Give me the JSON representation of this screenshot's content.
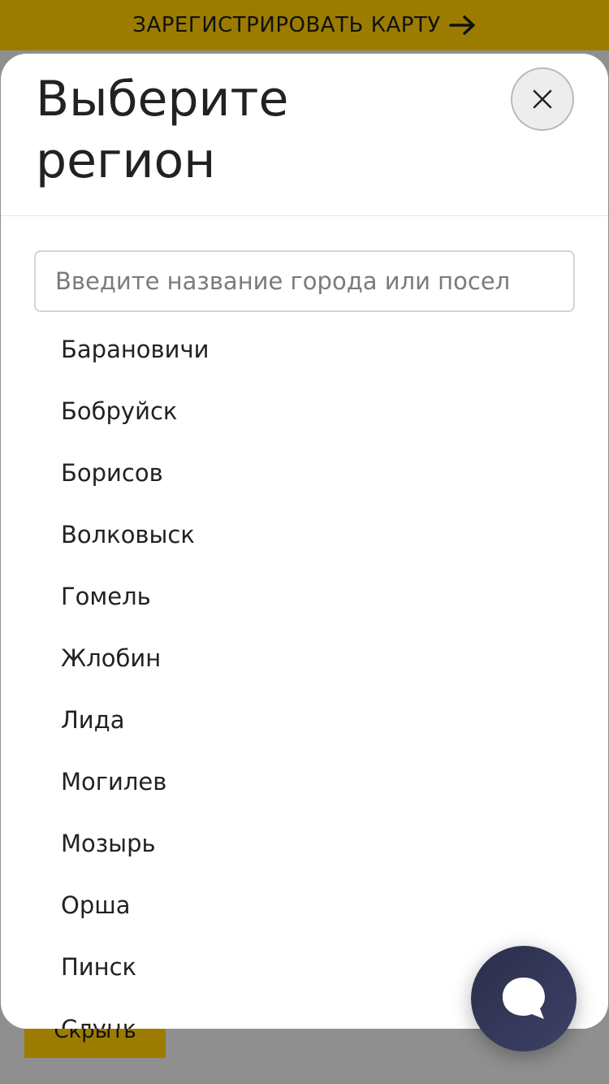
{
  "banner": {
    "label": "ЗАРЕГИСТРИРОВАТЬ КАРТУ",
    "icon": "arrow-right-icon"
  },
  "background_button": {
    "label": "Скрыть"
  },
  "modal": {
    "title": "Выберите регион",
    "close_icon": "close-icon"
  },
  "search": {
    "value": "",
    "placeholder": "Введите название города или посел"
  },
  "cities": [
    "Барановичи",
    "Бобруйск",
    "Борисов",
    "Волковыск",
    "Гомель",
    "Жлобин",
    "Лида",
    "Могилев",
    "Мозырь",
    "Орша",
    "Пинск",
    "Слуцк"
  ],
  "chat": {
    "icon": "chat-bubble-icon"
  },
  "colors": {
    "accent": "#9c7c00",
    "overlay": "#8f8f8f",
    "chat_button": "#2b2e4a"
  }
}
